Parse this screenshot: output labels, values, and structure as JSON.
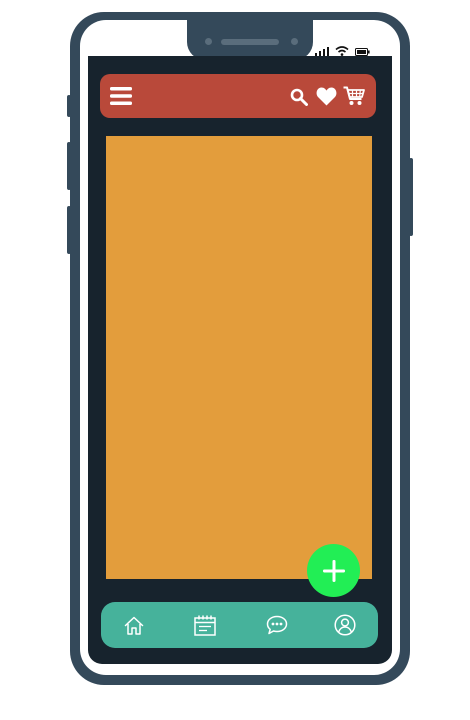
{
  "colors": {
    "phone_body": "#34495a",
    "screen": "#17232d",
    "top_bar": "#b9493a",
    "content": "#e39d3c",
    "fab": "#22ee55",
    "bottom_bar": "#46b29b"
  },
  "status_bar": {
    "icons": [
      "signal-icon",
      "wifi-icon",
      "battery-icon"
    ]
  },
  "top_bar": {
    "left_icons": [
      "menu-icon"
    ],
    "right_icons": [
      "search-icon",
      "heart-icon",
      "cart-icon"
    ]
  },
  "fab": {
    "icon": "plus-icon"
  },
  "bottom_nav": {
    "items": [
      "home-icon",
      "calendar-icon",
      "chat-icon",
      "profile-icon"
    ]
  }
}
